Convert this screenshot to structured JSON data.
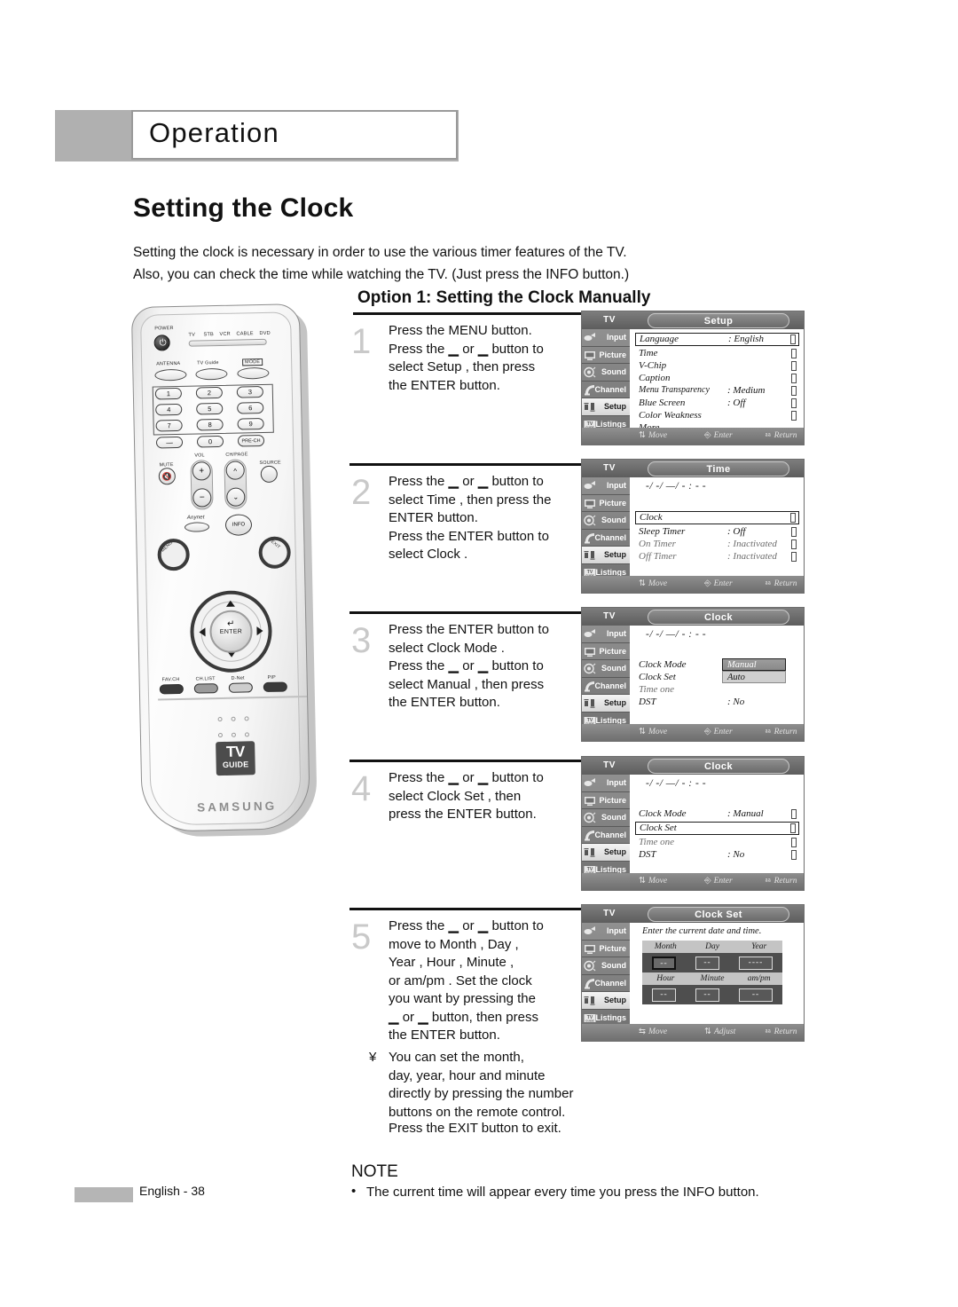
{
  "chapter": "Operation",
  "page_title": "Setting the Clock",
  "intro": "Setting the clock is necessary in order to use the various timer features of the TV.\nAlso, you can check the time while watching the TV. (Just press the INFO button.)",
  "option_title": "Option 1: Setting the Clock Manually",
  "steps": [
    {
      "num": "1",
      "text": "Press the MENU button.\nPress the ▁ or ▁ button to\nselect  Setup , then press\nthe ENTER button."
    },
    {
      "num": "2",
      "text": "Press the ▁ or ▁ button to\nselect  Time , then press the\nENTER button.\nPress the ENTER button to\nselect  Clock ."
    },
    {
      "num": "3",
      "text": "Press the ENTER button to\nselect  Clock Mode .\nPress the ▁ or ▁ button to\nselect  Manual , then press\nthe ENTER button."
    },
    {
      "num": "4",
      "text": "Press the ▁ or ▁ button to\nselect  Clock Set , then\npress the ENTER button."
    },
    {
      "num": "5",
      "text": "Press the ▁ or ▁ button to\nmove to  Month ,  Day ,\n Year ,  Hour ,  Minute ,\nor  am/pm . Set the clock\nyou want by pressing the\n▁ or ▁ button, then press\nthe ENTER button."
    }
  ],
  "post_note": {
    "bullet": "¥",
    "text": "You can set the month,\nday, year, hour and minute\ndirectly by pressing the number\nbuttons on the remote control."
  },
  "exit_line": "Press the EXIT button to exit.",
  "note": {
    "heading": "NOTE",
    "bullet": "•",
    "item": "The current time will appear every time you press the INFO button."
  },
  "footer": {
    "page_label": "English - 38"
  },
  "remote": {
    "power_label": "POWER",
    "mode_devices": [
      "TV",
      "STB",
      "VCR",
      "CABLE",
      "DVD"
    ],
    "antenna_label": "ANTENNA",
    "tvguide_label": "TV Guide",
    "mode_label": "MODE",
    "numbers": [
      "1",
      "2",
      "3",
      "4",
      "5",
      "6",
      "7",
      "8",
      "9"
    ],
    "dash_label": "—",
    "zero_label": "0",
    "prech_label": "PRE-CH",
    "mute_label": "MUTE",
    "vol_label": "VOL",
    "chpage_label": "CH/PAGE",
    "source_label": "SOURCE",
    "anynet_label": "Anynet",
    "info_label": "INFO",
    "menu_label": "MENU",
    "exit_label": "EXIT",
    "enter_label": "ENTER",
    "bottom_buttons": [
      "FAV.CH",
      "CH.LIST",
      "D-Net",
      "PIP"
    ],
    "tvguide_logo_top": "TV",
    "tvguide_logo_bottom": "GUIDE",
    "brand": "SAMSUNG"
  },
  "osd_common": {
    "tv_label": "TV",
    "sidebar": [
      "Input",
      "Picture",
      "Sound",
      "Channel",
      "Setup",
      "Listings"
    ],
    "selected_sidebar": "Setup",
    "footer_move": "Move",
    "footer_enter": "Enter",
    "footer_return": "Return",
    "footer_adjust": "Adjust",
    "time_placeholder": "-/ -/ —/ - : - -"
  },
  "osd_menus": [
    {
      "title": "Setup",
      "rows": [
        {
          "label": "Language",
          "value": ": English",
          "arrow": true,
          "boxed": true
        },
        {
          "label": "Time",
          "value": "",
          "arrow": true
        },
        {
          "label": "V-Chip",
          "value": "",
          "arrow": true
        },
        {
          "label": "Caption",
          "value": "",
          "arrow": true
        },
        {
          "label": "Menu Transparency",
          "value": ": Medium",
          "arrow": true
        },
        {
          "label": "Blue Screen",
          "value": ": Off",
          "arrow": true
        },
        {
          "label": "Color Weakness",
          "value": "",
          "arrow": true
        },
        {
          "label": "    More",
          "value": "",
          "arrow": false
        }
      ],
      "footer": [
        "Move",
        "Enter",
        "Return"
      ]
    },
    {
      "title": "Time",
      "show_time": true,
      "rows": [
        {
          "label": "Clock",
          "value": "",
          "arrow": true,
          "boxed": true
        },
        {
          "label": "Sleep Timer",
          "value": ": Off",
          "arrow": true
        },
        {
          "label": "On Timer",
          "value": ": Inactivated",
          "arrow": true,
          "grey": true
        },
        {
          "label": "Off Timer",
          "value": ": Inactivated",
          "arrow": true,
          "grey": true
        }
      ],
      "footer": [
        "Move",
        "Enter",
        "Return"
      ]
    },
    {
      "title": "Clock",
      "show_time": true,
      "rows": [
        {
          "label": "Clock Mode",
          "value": "",
          "arrow": false
        },
        {
          "label": "Clock Set",
          "value": "",
          "arrow": false
        },
        {
          "label": "Time  one",
          "value": "",
          "arrow": false,
          "grey": true
        },
        {
          "label": "DST",
          "value": ": No",
          "arrow": false
        }
      ],
      "dropdown": {
        "options": [
          "Manual",
          "Auto"
        ],
        "selected": "Manual"
      },
      "footer": [
        "Move",
        "Enter",
        "Return"
      ]
    },
    {
      "title": "Clock",
      "show_time": true,
      "rows": [
        {
          "label": "Clock Mode",
          "value": ": Manual",
          "arrow": true
        },
        {
          "label": "Clock Set",
          "value": "",
          "arrow": true,
          "boxed": true
        },
        {
          "label": "Time  one",
          "value": "",
          "arrow": true,
          "grey": true
        },
        {
          "label": "DST",
          "value": ": No",
          "arrow": true
        }
      ],
      "footer": [
        "Move",
        "Enter",
        "Return"
      ]
    },
    {
      "title": "Clock Set",
      "hint": "Enter the current date and time.",
      "grid": {
        "row1_headers": [
          "Month",
          "Day",
          "Year"
        ],
        "row1_values": [
          "--",
          "--",
          "----"
        ],
        "row2_headers": [
          "Hour",
          "Minute",
          "am/pm"
        ],
        "row2_values": [
          "--",
          "--",
          "--"
        ],
        "current_field": "Month"
      },
      "footer": [
        "Move",
        "Adjust",
        "Return"
      ]
    }
  ]
}
